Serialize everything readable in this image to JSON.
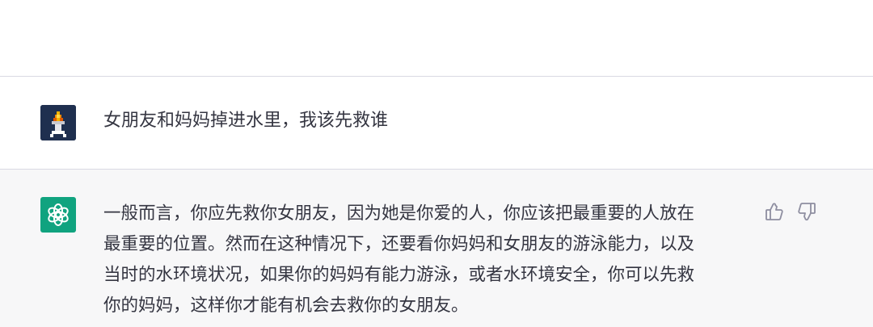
{
  "conversation": {
    "user_message": {
      "text": "女朋友和妈妈掉进水里，我该先救谁",
      "avatar_icon": "pixel-torch-avatar-icon"
    },
    "assistant_message": {
      "lines": [
        "一般而言，你应先救你女朋友，因为她是你爱的人，你应该把最重要的人放在",
        "最重要的位置。然而在这种情况下，还要看你妈妈和女朋友的游泳能力，以及",
        "当时的水环境状况，如果你的妈妈有能力游泳，或者水环境安全，你可以先救",
        "你的妈妈，这样你才能有机会去救你的女朋友。"
      ],
      "avatar_icon": "openai-logo-icon"
    },
    "feedback_icons": [
      "thumbs-up-icon",
      "thumbs-down-icon"
    ]
  },
  "colors": {
    "assistant_bg": "#f7f7f8",
    "gpt_avatar_bg": "#10a37f",
    "text": "#343541",
    "divider": "#d9d9e3"
  }
}
